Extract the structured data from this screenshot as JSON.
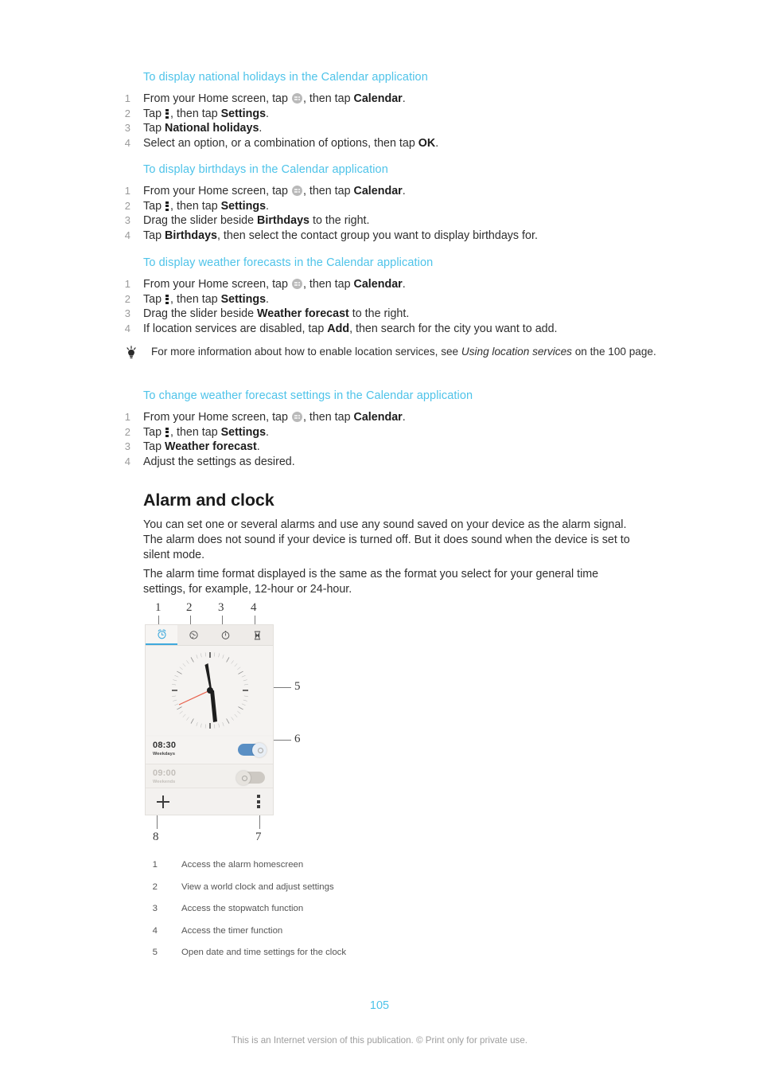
{
  "procedures": [
    {
      "title": "To display national holidays in the Calendar application",
      "steps": [
        {
          "num": "1",
          "pre": "From your Home screen, tap ",
          "icon": "app-drawer",
          "mid": ", then tap ",
          "bold": "Calendar",
          "post": "."
        },
        {
          "num": "2",
          "pre": "Tap ",
          "icon": "overflow",
          "mid": ", then tap ",
          "bold": "Settings",
          "post": "."
        },
        {
          "num": "3",
          "pre": "Tap ",
          "icon": "",
          "mid": "",
          "bold": "National holidays",
          "post": "."
        },
        {
          "num": "4",
          "pre": "Select an option, or a combination of options, then tap ",
          "icon": "",
          "mid": "",
          "bold": "OK",
          "post": "."
        }
      ]
    },
    {
      "title": "To display birthdays in the Calendar application",
      "steps": [
        {
          "num": "1",
          "pre": "From your Home screen, tap ",
          "icon": "app-drawer",
          "mid": ", then tap ",
          "bold": "Calendar",
          "post": "."
        },
        {
          "num": "2",
          "pre": "Tap ",
          "icon": "overflow",
          "mid": ", then tap ",
          "bold": "Settings",
          "post": "."
        },
        {
          "num": "3",
          "pre": "Drag the slider beside ",
          "icon": "",
          "mid": "",
          "bold": "Birthdays",
          "post": " to the right."
        },
        {
          "num": "4",
          "pre": "Tap ",
          "icon": "",
          "mid": "",
          "bold": "Birthdays",
          "post": ", then select the contact group you want to display birthdays for."
        }
      ]
    },
    {
      "title": "To display weather forecasts in the Calendar application",
      "steps": [
        {
          "num": "1",
          "pre": "From your Home screen, tap ",
          "icon": "app-drawer",
          "mid": ", then tap ",
          "bold": "Calendar",
          "post": "."
        },
        {
          "num": "2",
          "pre": "Tap ",
          "icon": "overflow",
          "mid": ", then tap ",
          "bold": "Settings",
          "post": "."
        },
        {
          "num": "3",
          "pre": "Drag the slider beside ",
          "icon": "",
          "mid": "",
          "bold": "Weather forecast",
          "post": " to the right."
        },
        {
          "num": "4",
          "pre": "If location services are disabled, tap ",
          "icon": "",
          "mid": "",
          "bold": "Add",
          "post": ", then search for the city you want to add."
        }
      ]
    },
    {
      "title": "To change weather forecast settings in the Calendar application",
      "steps": [
        {
          "num": "1",
          "pre": "From your Home screen, tap ",
          "icon": "app-drawer",
          "mid": ", then tap ",
          "bold": "Calendar",
          "post": "."
        },
        {
          "num": "2",
          "pre": "Tap ",
          "icon": "overflow",
          "mid": ", then tap ",
          "bold": "Settings",
          "post": "."
        },
        {
          "num": "3",
          "pre": "Tap ",
          "icon": "",
          "mid": "",
          "bold": "Weather forecast",
          "post": "."
        },
        {
          "num": "4",
          "pre": "Adjust the settings as desired.",
          "icon": "",
          "mid": "",
          "bold": "",
          "post": ""
        }
      ]
    }
  ],
  "tip": {
    "icon": "lightbulb-icon",
    "pre": "For more information about how to enable location services, see ",
    "italic": "Using location services",
    "post": " on the 100 page."
  },
  "section": {
    "heading": "Alarm and clock",
    "para1": "You can set one or several alarms and use any sound saved on your device as the alarm signal. The alarm does not sound if your device is turned off. But it does sound when the device is set to silent mode.",
    "para2": "The alarm time format displayed is the same as the format you select for your general time settings, for example, 12-hour or 24-hour."
  },
  "figure": {
    "callouts": {
      "c1": "1",
      "c2": "2",
      "c3": "3",
      "c4": "4",
      "c5": "5",
      "c6": "6",
      "c7": "7",
      "c8": "8"
    },
    "tabs": [
      {
        "name": "alarm-tab",
        "icon": "alarm-clock-icon",
        "active": true
      },
      {
        "name": "world-clock-tab",
        "icon": "globe-icon",
        "active": false
      },
      {
        "name": "stopwatch-tab",
        "icon": "stopwatch-icon",
        "active": false
      },
      {
        "name": "timer-tab",
        "icon": "hourglass-icon",
        "active": false
      }
    ],
    "alarms": [
      {
        "time": "08:30",
        "repeat": "Weekdays",
        "enabled": true
      },
      {
        "time": "09:00",
        "repeat": "Weekends",
        "enabled": false
      }
    ],
    "add_alarm_icon": "plus-icon",
    "overflow_icon": "overflow-menu-icon",
    "accent": "#3fa9dd",
    "toggle_on_color": "#5a8fc4",
    "toggle_off_color": "#cdc9c3"
  },
  "legend": [
    {
      "num": "1",
      "text": "Access the alarm homescreen"
    },
    {
      "num": "2",
      "text": "View a world clock and adjust settings"
    },
    {
      "num": "3",
      "text": "Access the stopwatch function"
    },
    {
      "num": "4",
      "text": "Access the timer function"
    },
    {
      "num": "5",
      "text": "Open date and time settings for the clock"
    }
  ],
  "footer": {
    "page_number": "105",
    "notice": "This is an Internet version of this publication. © Print only for private use."
  },
  "colors": {
    "heading_blue": "#4ec3e9",
    "text": "#2f2f2f",
    "muted": "#9d9d9d"
  }
}
